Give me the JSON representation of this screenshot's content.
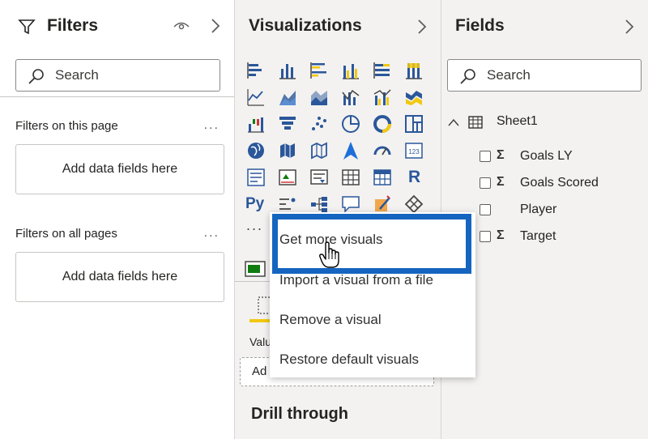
{
  "filters": {
    "title": "Filters",
    "search_placeholder": "Search",
    "on_this_page": "Filters on this page",
    "on_all_pages": "Filters on all pages",
    "drop_hint": "Add data fields here",
    "more": "..."
  },
  "visualizations": {
    "title": "Visualizations",
    "more": "...",
    "values_label": "Valu",
    "add_hint": "Ad",
    "drill_through": "Drill through",
    "r_label": "R",
    "py_label": "Py"
  },
  "fields": {
    "title": "Fields",
    "search_placeholder": "Search",
    "table_name": "Sheet1",
    "items": [
      {
        "name": "Goals LY",
        "sigma": true
      },
      {
        "name": "Goals Scored",
        "sigma": true
      },
      {
        "name": "Player",
        "sigma": false
      },
      {
        "name": "Target",
        "sigma": true
      }
    ]
  },
  "context_menu": {
    "items": [
      "Get more visuals",
      "Import a visual from a file",
      "Remove a visual",
      "Restore default visuals"
    ]
  },
  "colors": {
    "accent": "#1565c0",
    "visual_blue": "#2b579a",
    "visual_yellow": "#f2c811",
    "visual_green": "#107c10"
  }
}
